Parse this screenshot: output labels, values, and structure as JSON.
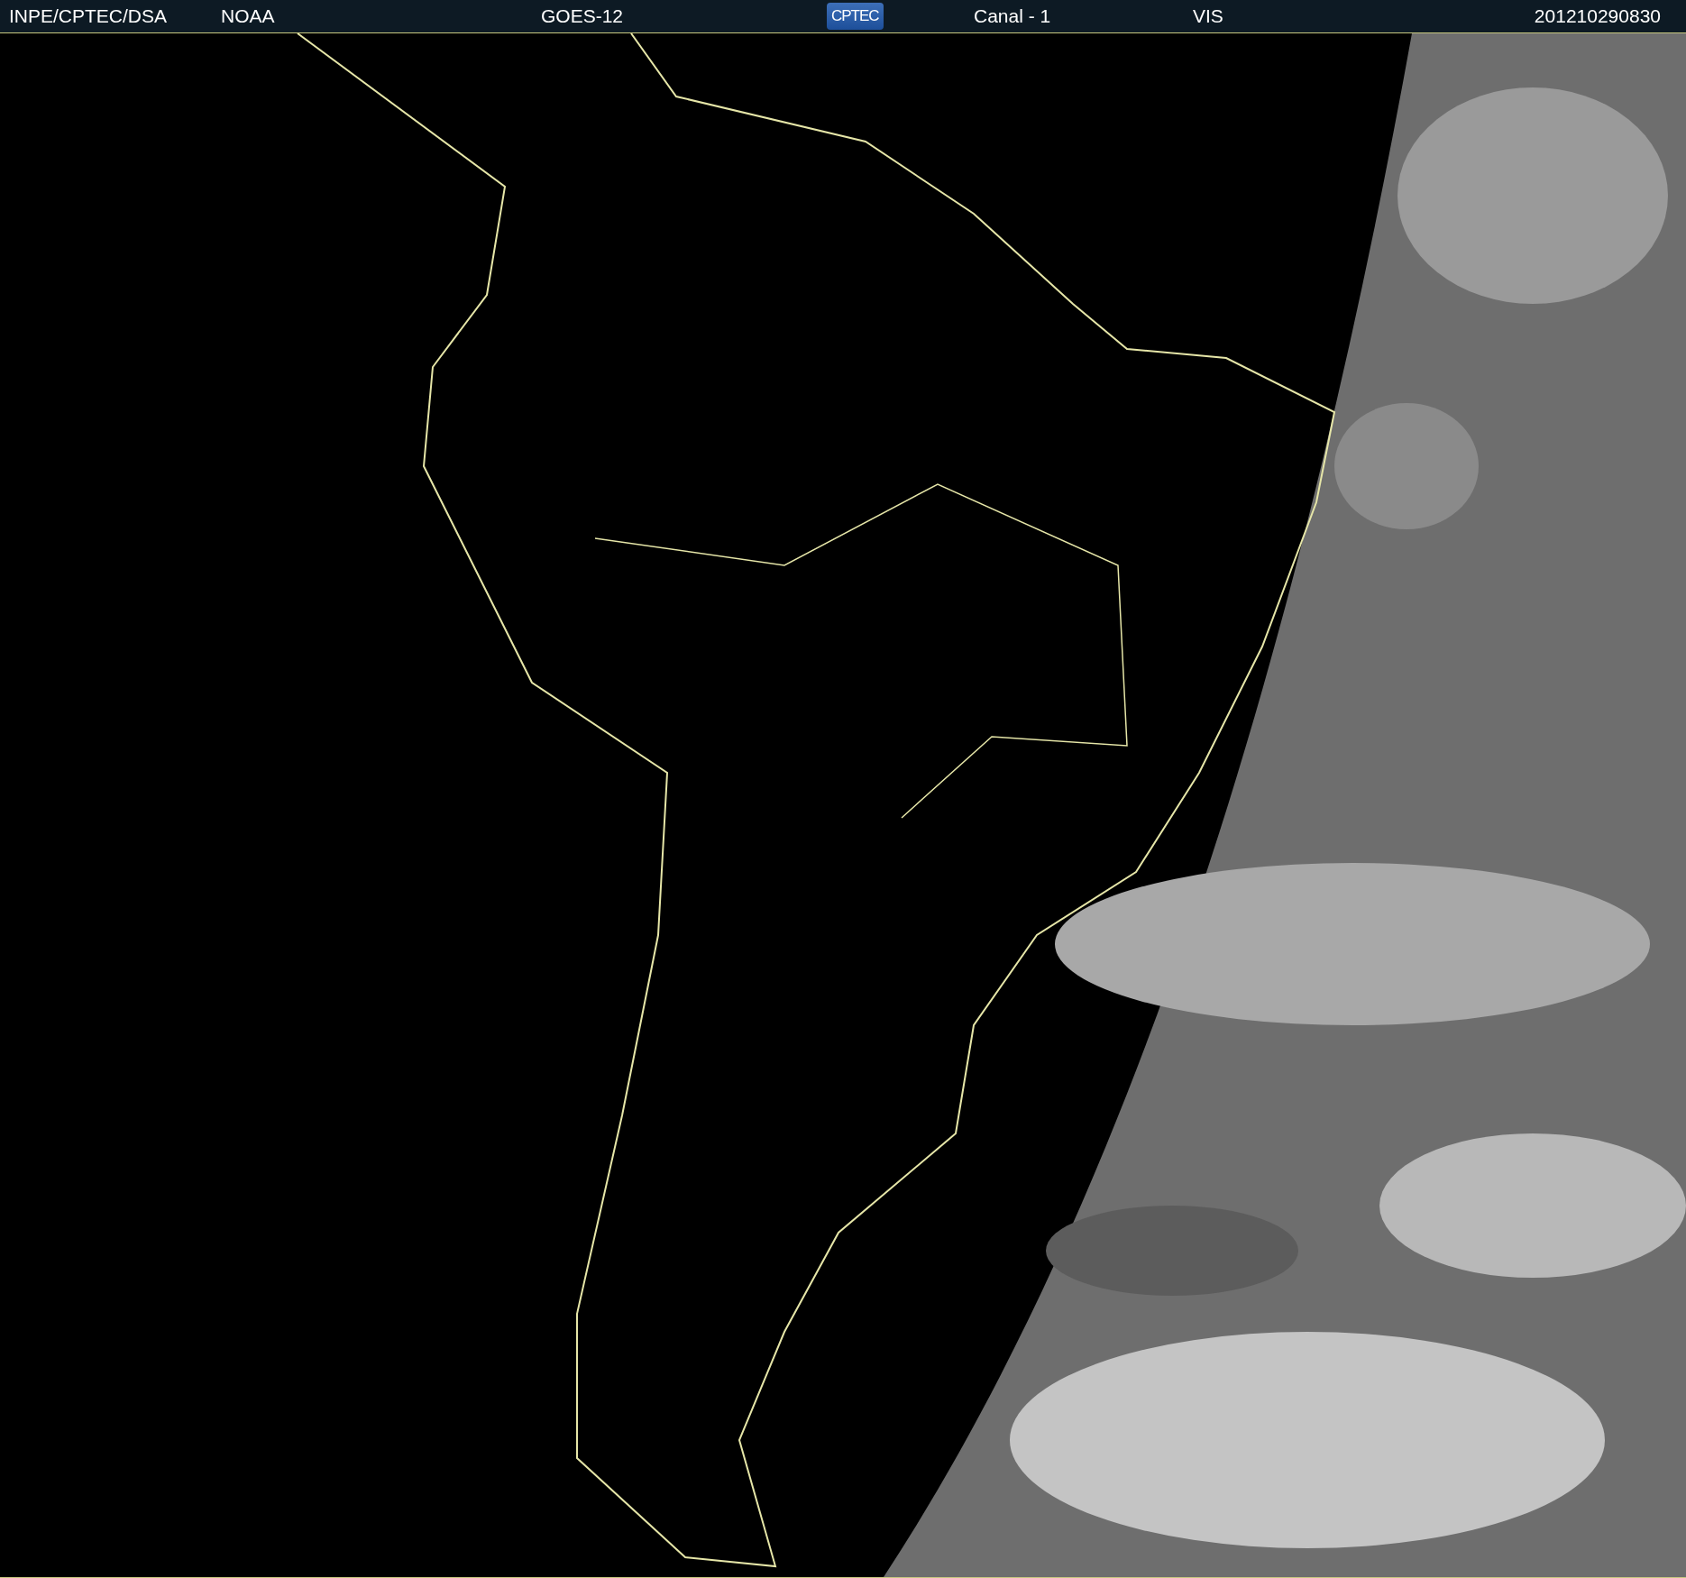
{
  "header": {
    "source": "INPE/CPTEC/DSA",
    "agency": "NOAA",
    "satellite": "GOES-12",
    "logo": "CPTEC",
    "channel": "Canal - 1",
    "band": "VIS",
    "timestamp": "201210290830"
  }
}
